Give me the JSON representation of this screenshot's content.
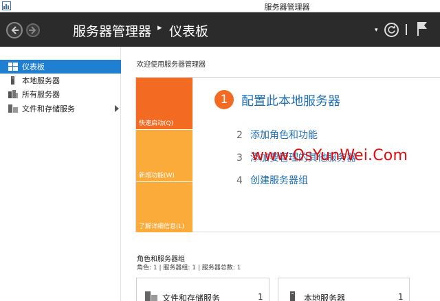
{
  "window": {
    "title": "服务器管理器"
  },
  "header": {
    "breadcrumb_root": "服务器管理器",
    "breadcrumb_sep": "▸",
    "breadcrumb_current": "仪表板"
  },
  "sidebar": {
    "items": [
      {
        "label": "仪表板",
        "icon": "dashboard-icon",
        "active": true
      },
      {
        "label": "本地服务器",
        "icon": "local-server-icon"
      },
      {
        "label": "所有服务器",
        "icon": "all-servers-icon"
      },
      {
        "label": "文件和存储服务",
        "icon": "file-storage-icon",
        "expandable": true
      }
    ]
  },
  "welcome": {
    "label": "欢迎使用服务器管理器",
    "tiles": {
      "quick_start": "快速启动(Q)",
      "whats_new": "新增功能(W)",
      "learn_more": "了解详细信息(L)"
    },
    "steps": [
      {
        "num": "1",
        "text": "配置此本地服务器"
      },
      {
        "num": "2",
        "text": "添加角色和功能"
      },
      {
        "num": "3",
        "text": "添加要管理的其他服务器"
      },
      {
        "num": "4",
        "text": "创建服务器组"
      }
    ],
    "watermark": "www.OsYunWei.Com"
  },
  "roles": {
    "title": "角色和服务器组",
    "summary": "角色: 1 | 服务器组: 1 | 服务器总数: 1",
    "cards": [
      {
        "label": "文件和存储服务",
        "count": "1",
        "icon": "file-storage-icon"
      },
      {
        "label": "本地服务器",
        "count": "1",
        "icon": "local-server-icon"
      }
    ]
  },
  "colors": {
    "header_bg": "#2b2b2b",
    "selection": "#1f7fd1",
    "tile_orange": "#f36b23",
    "tile_yellow": "#fbab3a",
    "link_blue": "#1f6fb6",
    "watermark_red": "#e10b0b"
  }
}
